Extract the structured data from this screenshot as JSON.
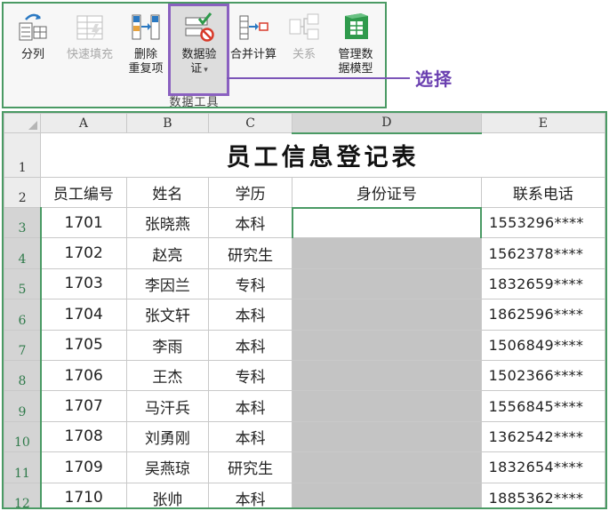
{
  "ribbon": {
    "buttons": [
      {
        "label": "分列",
        "icon": "text-to-columns-icon",
        "disabled": false
      },
      {
        "label": "快速填充",
        "icon": "flash-fill-icon",
        "disabled": true
      },
      {
        "label_line1": "删除",
        "label_line2": "重复项",
        "icon": "remove-duplicates-icon",
        "disabled": false
      },
      {
        "label_line1": "数据验",
        "label_line2": "证",
        "icon": "data-validation-icon",
        "disabled": false
      },
      {
        "label": "合并计算",
        "icon": "consolidate-icon",
        "disabled": false
      },
      {
        "label": "关系",
        "icon": "relationships-icon",
        "disabled": true
      },
      {
        "label_line1": "管理数",
        "label_line2": "据模型",
        "icon": "manage-data-model-icon",
        "disabled": false
      }
    ],
    "group_label": "数据工具"
  },
  "callout": "选择",
  "sheet": {
    "columns": [
      "A",
      "B",
      "C",
      "D",
      "E"
    ],
    "title": "员工信息登记表",
    "headers": [
      "员工编号",
      "姓名",
      "学历",
      "身份证号",
      "联系电话"
    ],
    "rows": [
      {
        "n": "3",
        "id": "1701",
        "name": "张晓燕",
        "edu": "本科",
        "idcard": "",
        "phone": "1553296****"
      },
      {
        "n": "4",
        "id": "1702",
        "name": "赵亮",
        "edu": "研究生",
        "idcard": "",
        "phone": "1562378****"
      },
      {
        "n": "5",
        "id": "1703",
        "name": "李因兰",
        "edu": "专科",
        "idcard": "",
        "phone": "1832659****"
      },
      {
        "n": "6",
        "id": "1704",
        "name": "张文轩",
        "edu": "本科",
        "idcard": "",
        "phone": "1862596****"
      },
      {
        "n": "7",
        "id": "1705",
        "name": "李雨",
        "edu": "本科",
        "idcard": "",
        "phone": "1506849****"
      },
      {
        "n": "8",
        "id": "1706",
        "name": "王杰",
        "edu": "专科",
        "idcard": "",
        "phone": "1502366****"
      },
      {
        "n": "9",
        "id": "1707",
        "name": "马汗兵",
        "edu": "本科",
        "idcard": "",
        "phone": "1556845****"
      },
      {
        "n": "10",
        "id": "1708",
        "name": "刘勇刚",
        "edu": "本科",
        "idcard": "",
        "phone": "1362542****"
      },
      {
        "n": "11",
        "id": "1709",
        "name": "吴燕琼",
        "edu": "研究生",
        "idcard": "",
        "phone": "1832654****"
      },
      {
        "n": "12",
        "id": "1710",
        "name": "张帅",
        "edu": "本科",
        "idcard": "",
        "phone": "1885362****"
      }
    ]
  },
  "colors": {
    "accent_green": "#4a9a64",
    "highlight_purple": "#7c55b8",
    "selection_gray": "#c4c4c4"
  }
}
